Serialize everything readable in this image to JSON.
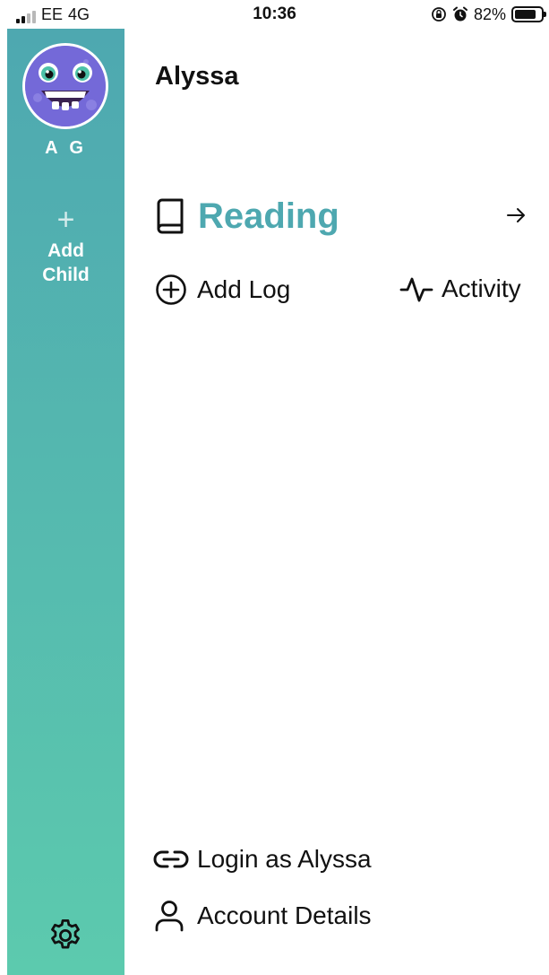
{
  "status_bar": {
    "carrier": "EE",
    "network": "4G",
    "time": "10:36",
    "battery": "82%",
    "battery_level": 0.82
  },
  "sidebar": {
    "avatar_initials": "A G",
    "add_child_label": "Add\nChild",
    "icons": [
      "monster-avatar-icon",
      "plus-icon",
      "gear-icon"
    ]
  },
  "main": {
    "child_name": "Alyssa",
    "subject": {
      "title": "Reading",
      "icon": "book-icon",
      "arrow_icon": "arrow-right-icon"
    },
    "add_log_label": "Add Log",
    "activity_label": "Activity",
    "login_as_label": "Login as Alyssa",
    "account_details_label": "Account Details"
  },
  "colors": {
    "accent": "#4ea8b0",
    "sidebar_top": "#4ea8b0",
    "sidebar_bottom": "#5ccaae",
    "avatar": "#7469d8"
  }
}
